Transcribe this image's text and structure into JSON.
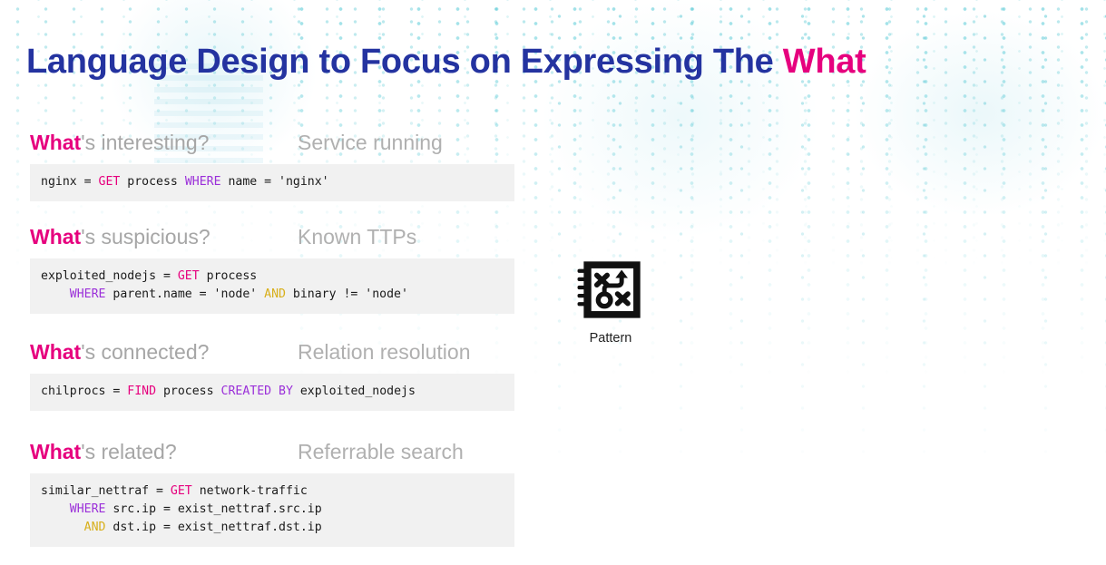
{
  "slide": {
    "title_main": "Language Design to Focus on Expressing The ",
    "title_accent": "What"
  },
  "sections": [
    {
      "question_what": "What",
      "question_rest": "'s interesting?",
      "tag": "Service running",
      "code_lines": [
        [
          {
            "t": "nginx = ",
            "c": "plain"
          },
          {
            "t": "GET",
            "c": "get"
          },
          {
            "t": " process ",
            "c": "plain"
          },
          {
            "t": "WHERE",
            "c": "where"
          },
          {
            "t": " name = 'nginx'",
            "c": "plain"
          }
        ]
      ],
      "code_text": "nginx = GET process WHERE name = 'nginx'"
    },
    {
      "question_what": "What",
      "question_rest": "'s suspicious?",
      "tag": "Known TTPs",
      "code_lines": [
        [
          {
            "t": "exploited_nodejs = ",
            "c": "plain"
          },
          {
            "t": "GET",
            "c": "get"
          },
          {
            "t": " process",
            "c": "plain"
          }
        ],
        [
          {
            "t": "    ",
            "c": "plain"
          },
          {
            "t": "WHERE",
            "c": "where"
          },
          {
            "t": " parent.name = 'node' ",
            "c": "plain"
          },
          {
            "t": "AND",
            "c": "and"
          },
          {
            "t": " binary != 'node'",
            "c": "plain"
          }
        ]
      ],
      "code_text": "exploited_nodejs = GET process\n    WHERE parent.name = 'node' AND binary != 'node'"
    },
    {
      "question_what": "What",
      "question_rest": "'s connected?",
      "tag": "Relation resolution",
      "code_lines": [
        [
          {
            "t": "chilprocs = ",
            "c": "plain"
          },
          {
            "t": "FIND",
            "c": "get"
          },
          {
            "t": " process ",
            "c": "plain"
          },
          {
            "t": "CREATED BY",
            "c": "where"
          },
          {
            "t": " exploited_nodejs",
            "c": "plain"
          }
        ]
      ],
      "code_text": "chilprocs = FIND process CREATED BY exploited_nodejs"
    },
    {
      "question_what": "What",
      "question_rest": "'s related?",
      "tag": "Referrable search",
      "code_lines": [
        [
          {
            "t": "similar_nettraf = ",
            "c": "plain"
          },
          {
            "t": "GET",
            "c": "get"
          },
          {
            "t": " network-traffic",
            "c": "plain"
          }
        ],
        [
          {
            "t": "    ",
            "c": "plain"
          },
          {
            "t": "WHERE",
            "c": "where"
          },
          {
            "t": " src.ip = exist_nettraf.src.ip",
            "c": "plain"
          }
        ],
        [
          {
            "t": "      ",
            "c": "plain"
          },
          {
            "t": "AND",
            "c": "and"
          },
          {
            "t": " dst.ip = exist_nettraf.dst.ip",
            "c": "plain"
          }
        ]
      ],
      "code_text": "similar_nettraf = GET network-traffic\n    WHERE src.ip = exist_nettraf.src.ip\n      AND dst.ip = exist_nettraf.dst.ip"
    }
  ],
  "pattern_widget": {
    "icon_name": "strategy-playbook-icon",
    "label": "Pattern"
  },
  "colors": {
    "title_blue": "#2433A0",
    "accent_magenta": "#E6007E",
    "heading_gray": "#a6a6a6",
    "tag_gray": "#b0b0b0",
    "code_bg": "#f1f1f1",
    "code_fg": "#1a1a1a",
    "keyword_get": "#E6007E",
    "keyword_where": "#9B30D9",
    "keyword_and": "#D8AF1A",
    "background": "#ffffff",
    "circuit_dots": "#5fc9d6"
  }
}
